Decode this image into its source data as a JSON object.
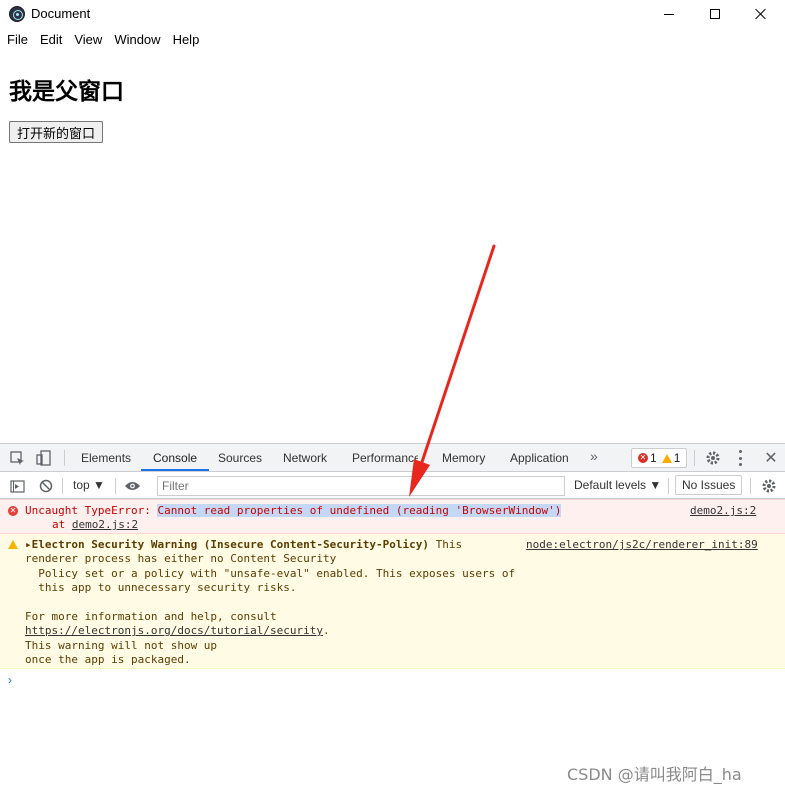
{
  "window": {
    "title": "Document",
    "icon": "electron-icon"
  },
  "menu": [
    "File",
    "Edit",
    "View",
    "Window",
    "Help"
  ],
  "page": {
    "heading": "我是父窗口",
    "open_button": "打开新的窗口"
  },
  "devtools": {
    "tabs": [
      "Elements",
      "Console",
      "Sources",
      "Network",
      "Performance",
      "Memory",
      "Application"
    ],
    "active_tab": "Console",
    "more_tabs": "»",
    "error_count": "1",
    "warning_count": "1",
    "context": "top ▼",
    "filter_placeholder": "Filter",
    "levels": "Default levels ▼",
    "issues": "No Issues",
    "error": {
      "prefix": "Uncaught TypeError: ",
      "message": "Cannot read properties of undefined (reading 'BrowserWindow')",
      "at": "at ",
      "location": "demo2.js:2",
      "source": "demo2.js:2"
    },
    "warning": {
      "title": "Electron Security Warning (Insecure Content-Security-Policy)",
      "line1_tail": " This",
      "line2": "renderer process has either no Content Security",
      "line3": "  Policy set or a policy with \"unsafe-eval\" enabled. This exposes users of",
      "line4": "  this app to unnecessary security risks.",
      "line5": "For more information and help, consult",
      "link": "https://electronjs.org/docs/tutorial/security",
      "link_tail": ".",
      "line6": "This warning will not show up",
      "line7": "once the app is packaged.",
      "source": "node:electron/js2c/renderer_init:89"
    },
    "prompt": "›"
  },
  "watermark": "CSDN @请叫我阿白_ha",
  "colors": {
    "error_text": "#c80000",
    "error_bg": "#fff0f0",
    "warning_bg": "#fffbe5",
    "highlight": "#c4d8f5",
    "arrow": "#e8281e",
    "active_tab": "#1a73e8"
  }
}
